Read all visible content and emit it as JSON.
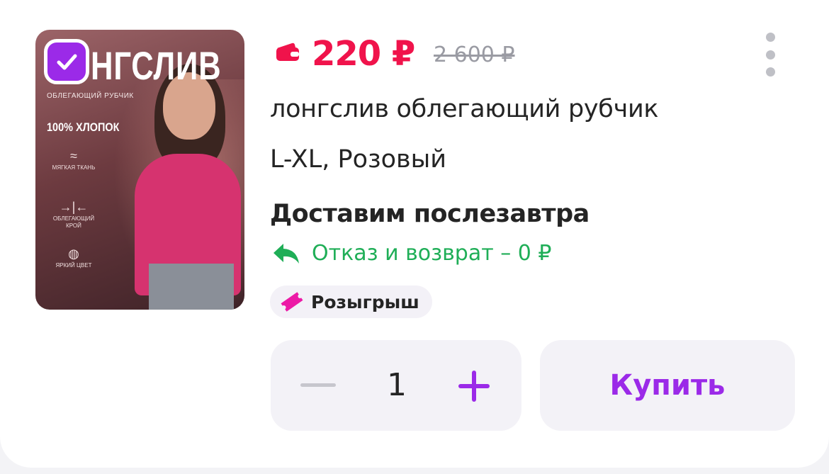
{
  "product": {
    "image_brand_text": "НГСЛИВ",
    "image_subtitle": "ОБЛЕГАЮЩИЙ РУБЧИК",
    "image_cotton": "100% ХЛОПОК",
    "image_features": [
      {
        "icon": "feather-icon",
        "label": "МЯГКАЯ ТКАНЬ"
      },
      {
        "icon": "fit-arrows-icon",
        "label": "ОБЛЕГАЮЩИЙ КРОЙ"
      },
      {
        "icon": "palette-icon",
        "label": "ЯРКИЙ ЦВЕТ"
      }
    ],
    "price": "220 ₽",
    "old_price": "2 600 ₽",
    "title": "лонгслив облегающий рубчик",
    "variant": "L-XL, Розовый",
    "delivery": "Доставим послезавтра",
    "return_policy": "Отказ и возврат – 0 ₽",
    "badge": "Розыгрыш"
  },
  "cart": {
    "quantity": "1",
    "buy_label": "Купить"
  },
  "colors": {
    "price": "#f0134b",
    "accent": "#9b2ae8",
    "return": "#1fae57",
    "muted": "#9a9ba3"
  }
}
